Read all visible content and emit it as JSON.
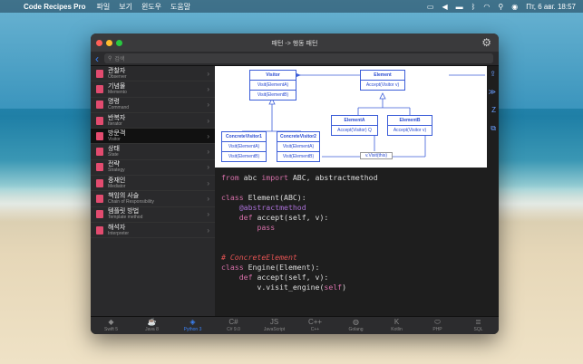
{
  "menubar": {
    "app": "Code Recipes Pro",
    "menus": [
      "파일",
      "보기",
      "윈도우",
      "도움말"
    ],
    "clock": "Пт, 6 авг. 18:57"
  },
  "window": {
    "title": "패턴 -> 행동 패턴",
    "search_placeholder": "검색"
  },
  "sidebar": {
    "items": [
      {
        "kr": "관찰자",
        "en": "Observer"
      },
      {
        "kr": "기념물",
        "en": "Memento"
      },
      {
        "kr": "명령",
        "en": "Command"
      },
      {
        "kr": "반복자",
        "en": "Iterator"
      },
      {
        "kr": "방문객",
        "en": "Visitor"
      },
      {
        "kr": "상태",
        "en": "State"
      },
      {
        "kr": "전략",
        "en": "Strategy"
      },
      {
        "kr": "중재인",
        "en": "Mediator"
      },
      {
        "kr": "책임의 사슬",
        "en": "Chain of Responsibility"
      },
      {
        "kr": "템플릿 방법",
        "en": "Template method"
      },
      {
        "kr": "해석자",
        "en": "Interpreter"
      }
    ],
    "selected": "방문객"
  },
  "diagram": {
    "visitor": {
      "name": "Visitor",
      "rows": [
        "Visit(ElementA)",
        "Visit(ElementB)"
      ]
    },
    "element": {
      "name": "Element",
      "rows": [
        "Accept(Visitor v)"
      ]
    },
    "cv1": {
      "name": "ConcreteVisitor1",
      "rows": [
        "Visit(ElementA)",
        "Visit(ElementB)"
      ]
    },
    "cv2": {
      "name": "ConcreteVisitor2",
      "rows": [
        "Visit(ElementA)",
        "Visit(ElementB)"
      ]
    },
    "ea": {
      "name": "ElementA",
      "rows": [
        "Accept(Visitor) Q"
      ]
    },
    "eb": {
      "name": "ElementB",
      "rows": [
        "Accept(Visitor v)"
      ]
    },
    "note": "v.Visit(this)"
  },
  "code": {
    "l1a": "from",
    "l1b": " abc ",
    "l1c": "import",
    "l1d": " ABC, abstractmethod",
    "l2a": "class",
    "l2b": " Element(ABC):",
    "l3": "@abstractmethod",
    "l4a": "def",
    "l4b": " accept(self, v):",
    "l5": "pass",
    "l6": "# ConcreteElement",
    "l7a": "class",
    "l7b": " Engine(Element):",
    "l8a": "def",
    "l8b": " accept(self, v):",
    "l9a": "v.visit_engine(",
    "l9b": "self",
    "l9c": ")"
  },
  "tabs": [
    "Swift 5",
    "Java 8",
    "Python 3",
    "C# 9.0",
    "JavaScript",
    "C++",
    "Golang",
    "Kotlin",
    "PHP",
    "SQL"
  ],
  "active_tab": "Python 3",
  "colors": {
    "accent": "#3b82f6",
    "keyword": "#d56fa8",
    "comment": "#e35353",
    "icon_red": "#e24b6f"
  }
}
